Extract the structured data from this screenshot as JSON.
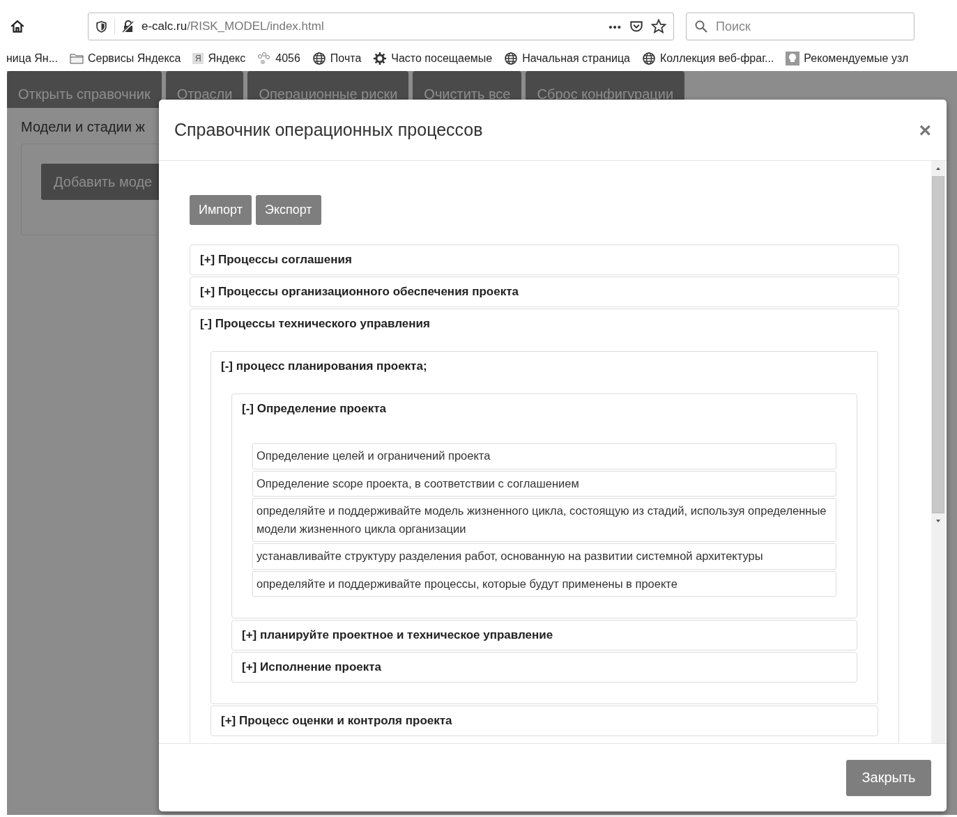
{
  "browser": {
    "url_domain": "e-calc.ru",
    "url_path": "/RISK_MODEL/index.html",
    "menu_dots": "•••",
    "search_placeholder": "Поиск",
    "bookmarks": [
      {
        "kind": "none",
        "label": "ница Ян..."
      },
      {
        "kind": "folder",
        "label": "Сервисы Яндекса"
      },
      {
        "kind": "yandex",
        "label": "Яндекс",
        "icon_text": "Я"
      },
      {
        "kind": "nodes",
        "label": "4056"
      },
      {
        "kind": "globe",
        "label": "Почта"
      },
      {
        "kind": "gear",
        "label": "Часто посещаемые"
      },
      {
        "kind": "globe",
        "label": "Начальная страница"
      },
      {
        "kind": "globe",
        "label": "Коллекция веб-фраг..."
      },
      {
        "kind": "bulb",
        "label": "Рекомендуемые узл"
      }
    ]
  },
  "nav_tabs": [
    "Открыть справочник",
    "Отрасли",
    "Операционные риски",
    "Очистить все",
    "Сброс конфигурации"
  ],
  "page": {
    "heading": "Модели и стадии ж",
    "add_button": "Добавить моде"
  },
  "modal": {
    "title": "Справочник операционных процессов",
    "close": "×",
    "buttons": [
      "Импорт",
      "Экспорт"
    ],
    "sections": [
      {
        "label": "[+] Процессы соглашения",
        "expanded": false
      },
      {
        "label": "[+] Процессы организационного обеспечения проекта",
        "expanded": false
      },
      {
        "label": "[-] Процессы технического управления",
        "expanded": true,
        "children": [
          {
            "label": "[-] процесс планирования проекта;",
            "expanded": true,
            "children": [
              {
                "label": "[-] Определение проекта",
                "expanded": true,
                "items": [
                  "Определение целей и ограничений проекта",
                  "Определение scope проекта, в соответствии с соглашением",
                  "определяйте и поддерживайте модель жизненного цикла, состоящую из стадий, используя определенные модели жизненного цикла организации",
                  "устанавливайте структуру разделения работ, основанную на развитии системной архитектуры",
                  "определяйте и поддерживайте процессы, которые будут применены в проекте"
                ]
              },
              {
                "label": "[+] планируйте проектное и техническое управление",
                "expanded": false
              },
              {
                "label": "[+] Исполнение проекта",
                "expanded": false
              }
            ]
          },
          {
            "label": "[+] Процесс оценки и контроля проекта",
            "expanded": false
          }
        ]
      }
    ],
    "footer_button": "Закрыть"
  }
}
